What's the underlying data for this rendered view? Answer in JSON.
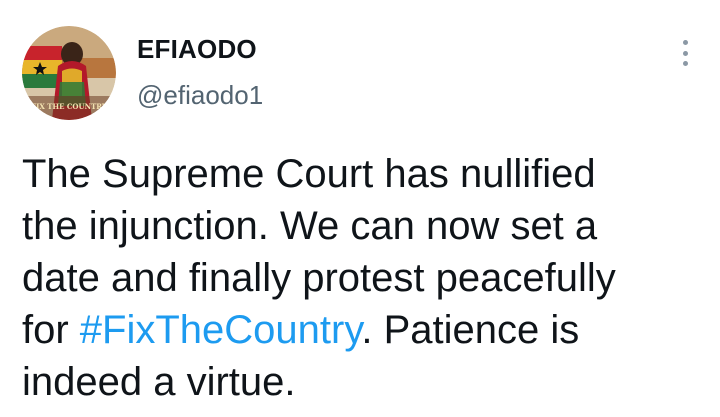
{
  "author": {
    "display_name": "EFIAODO",
    "handle": "@efiaodo1",
    "avatar_caption": "FIX THE COUNTRY"
  },
  "tweet": {
    "text_before": "The Supreme Court has nullified\nthe injunction. We can now set a\ndate and finally protest peacefully\nfor ",
    "hashtag": "#FixTheCountry",
    "text_after": ". Patience is\nindeed a virtue."
  },
  "menu": {
    "icon": "more-vertical-icon"
  },
  "colors": {
    "text": "#0f1419",
    "secondary": "#536471",
    "link": "#1d9bf0"
  }
}
